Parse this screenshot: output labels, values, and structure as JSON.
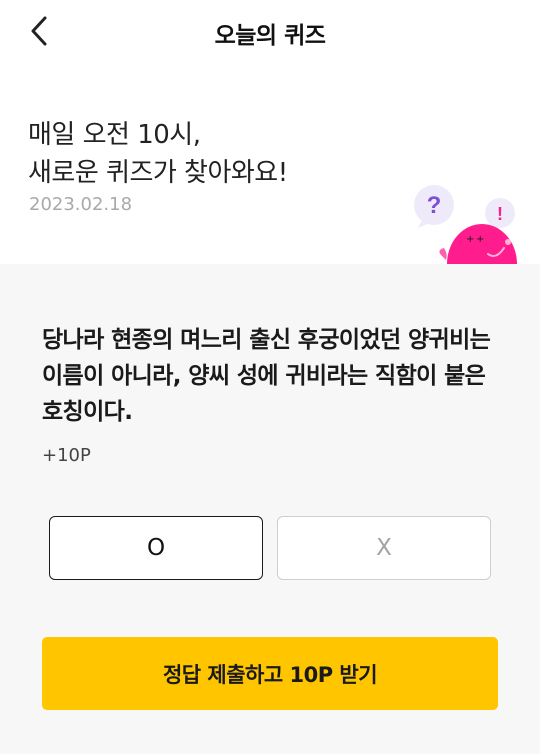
{
  "header": {
    "title": "오늘의 퀴즈",
    "back_icon": "chevron-left-icon"
  },
  "hero": {
    "line1": "매일 오전 10시,",
    "line2": "새로운 퀴즈가 찾아와요!",
    "date": "2023.02.18",
    "mascot_question_mark": "?",
    "mascot_exclamation": "!"
  },
  "quiz": {
    "question": "당나라 현종의 며느리 출신 후궁이었던 양귀비는 이름이 아니라, 양씨 성에 귀비라는 직함이 붙은 호칭이다.",
    "points": "+10P",
    "option_o": "O",
    "option_x": "X",
    "submit_label": "정답 제출하고 10P 받기"
  },
  "colors": {
    "accent": "#ffc600",
    "mascot_pink": "#ff1d8e",
    "question_mark_purple": "#7b4fd6",
    "background_gray": "#f7f7f7"
  }
}
